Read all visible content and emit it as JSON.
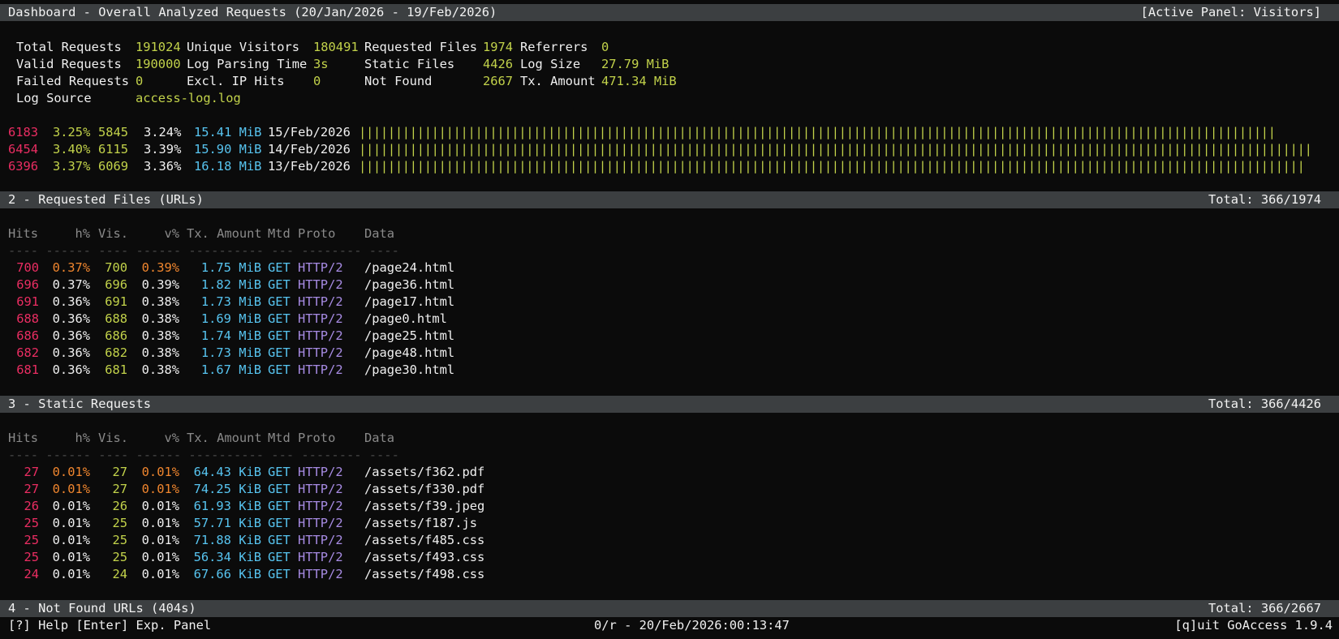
{
  "header": {
    "title": "Dashboard - Overall Analyzed Requests (20/Jan/2026 - 19/Feb/2026)",
    "active_panel": "[Active Panel: Visitors]"
  },
  "overall": {
    "total_requests_label": "Total Requests",
    "total_requests": "191024",
    "unique_visitors_label": "Unique Visitors",
    "unique_visitors": "180491",
    "requested_files_label": "Requested Files",
    "requested_files": "1974",
    "referrers_label": "Referrers",
    "referrers": "0",
    "valid_requests_label": "Valid Requests",
    "valid_requests": "190000",
    "log_parsing_time_label": "Log Parsing Time",
    "log_parsing_time": "3s",
    "static_files_label": "Static Files",
    "static_files": "4426",
    "log_size_label": "Log Size",
    "log_size": "27.79 MiB",
    "failed_requests_label": "Failed Requests",
    "failed_requests": "0",
    "excl_ip_hits_label": "Excl. IP Hits",
    "excl_ip_hits": "0",
    "not_found_label": "Not Found",
    "not_found": "2667",
    "tx_amount_label": "Tx. Amount",
    "tx_amount": "471.34 MiB",
    "log_source_label": "Log Source",
    "log_source": "access-log.log"
  },
  "visitors": {
    "rows": [
      {
        "hits": "6183",
        "hpct": "3.25%",
        "vis": "5845",
        "vpct": "3.24%",
        "tx": "15.41 MiB",
        "date": "15/Feb/2026",
        "bar_fraction": 0.957
      },
      {
        "hits": "6454",
        "hpct": "3.40%",
        "vis": "6115",
        "vpct": "3.39%",
        "tx": "15.90 MiB",
        "date": "14/Feb/2026",
        "bar_fraction": 1.0
      },
      {
        "hits": "6396",
        "hpct": "3.37%",
        "vis": "6069",
        "vpct": "3.36%",
        "tx": "16.18 MiB",
        "date": "13/Feb/2026",
        "bar_fraction": 0.99
      }
    ]
  },
  "requested_files": {
    "title": "2 - Requested Files (URLs)",
    "total": "Total: 366/1974",
    "columns": {
      "hits": "Hits",
      "hpct": "h%",
      "vis": "Vis.",
      "vpct": "v%",
      "tx": "Tx. Amount",
      "mtd": "Mtd",
      "proto": "Proto",
      "data": "Data"
    },
    "separator": "---- ------ ---- ------ ---------- --- -------- ----",
    "rows": [
      {
        "hits": "700",
        "hpct": "0.37%",
        "vis": "700",
        "vpct": "0.39%",
        "tx": "1.75 MiB",
        "mtd": "GET",
        "proto": "HTTP/2",
        "data": "/page24.html",
        "highlight": true
      },
      {
        "hits": "696",
        "hpct": "0.37%",
        "vis": "696",
        "vpct": "0.39%",
        "tx": "1.82 MiB",
        "mtd": "GET",
        "proto": "HTTP/2",
        "data": "/page36.html",
        "highlight": false
      },
      {
        "hits": "691",
        "hpct": "0.36%",
        "vis": "691",
        "vpct": "0.38%",
        "tx": "1.73 MiB",
        "mtd": "GET",
        "proto": "HTTP/2",
        "data": "/page17.html",
        "highlight": false
      },
      {
        "hits": "688",
        "hpct": "0.36%",
        "vis": "688",
        "vpct": "0.38%",
        "tx": "1.69 MiB",
        "mtd": "GET",
        "proto": "HTTP/2",
        "data": "/page0.html",
        "highlight": false
      },
      {
        "hits": "686",
        "hpct": "0.36%",
        "vis": "686",
        "vpct": "0.38%",
        "tx": "1.74 MiB",
        "mtd": "GET",
        "proto": "HTTP/2",
        "data": "/page25.html",
        "highlight": false
      },
      {
        "hits": "682",
        "hpct": "0.36%",
        "vis": "682",
        "vpct": "0.38%",
        "tx": "1.73 MiB",
        "mtd": "GET",
        "proto": "HTTP/2",
        "data": "/page48.html",
        "highlight": false
      },
      {
        "hits": "681",
        "hpct": "0.36%",
        "vis": "681",
        "vpct": "0.38%",
        "tx": "1.67 MiB",
        "mtd": "GET",
        "proto": "HTTP/2",
        "data": "/page30.html",
        "highlight": false
      }
    ]
  },
  "static_requests": {
    "title": "3 - Static Requests",
    "total": "Total: 366/4426",
    "columns": {
      "hits": "Hits",
      "hpct": "h%",
      "vis": "Vis.",
      "vpct": "v%",
      "tx": "Tx. Amount",
      "mtd": "Mtd",
      "proto": "Proto",
      "data": "Data"
    },
    "separator": "---- ------ ---- ------ ---------- --- -------- ----",
    "rows": [
      {
        "hits": "27",
        "hpct": "0.01%",
        "vis": "27",
        "vpct": "0.01%",
        "tx": "64.43 KiB",
        "mtd": "GET",
        "proto": "HTTP/2",
        "data": "/assets/f362.pdf",
        "highlight": true
      },
      {
        "hits": "27",
        "hpct": "0.01%",
        "vis": "27",
        "vpct": "0.01%",
        "tx": "74.25 KiB",
        "mtd": "GET",
        "proto": "HTTP/2",
        "data": "/assets/f330.pdf",
        "highlight": true
      },
      {
        "hits": "26",
        "hpct": "0.01%",
        "vis": "26",
        "vpct": "0.01%",
        "tx": "61.93 KiB",
        "mtd": "GET",
        "proto": "HTTP/2",
        "data": "/assets/f39.jpeg",
        "highlight": false
      },
      {
        "hits": "25",
        "hpct": "0.01%",
        "vis": "25",
        "vpct": "0.01%",
        "tx": "57.71 KiB",
        "mtd": "GET",
        "proto": "HTTP/2",
        "data": "/assets/f187.js",
        "highlight": false
      },
      {
        "hits": "25",
        "hpct": "0.01%",
        "vis": "25",
        "vpct": "0.01%",
        "tx": "71.88 KiB",
        "mtd": "GET",
        "proto": "HTTP/2",
        "data": "/assets/f485.css",
        "highlight": false
      },
      {
        "hits": "25",
        "hpct": "0.01%",
        "vis": "25",
        "vpct": "0.01%",
        "tx": "56.34 KiB",
        "mtd": "GET",
        "proto": "HTTP/2",
        "data": "/assets/f493.css",
        "highlight": false
      },
      {
        "hits": "24",
        "hpct": "0.01%",
        "vis": "24",
        "vpct": "0.01%",
        "tx": "67.66 KiB",
        "mtd": "GET",
        "proto": "HTTP/2",
        "data": "/assets/f498.css",
        "highlight": false
      }
    ]
  },
  "not_found": {
    "title": "4 - Not Found URLs (404s)",
    "total": "Total: 366/2667"
  },
  "footer": {
    "help": "[?] Help [Enter] Exp. Panel",
    "status": "0/r - 20/Feb/2026:00:13:47",
    "quit": "[q]uit GoAccess 1.9.4"
  },
  "colors": {
    "background": "#0b0b0b",
    "bar": "#3c3f41",
    "value": "#c2d24a",
    "hits": "#ea2d62",
    "highlight_pct": "#f0862e",
    "tx": "#57c4f0",
    "proto": "#a78be3",
    "column_header": "#8a8a8a"
  }
}
